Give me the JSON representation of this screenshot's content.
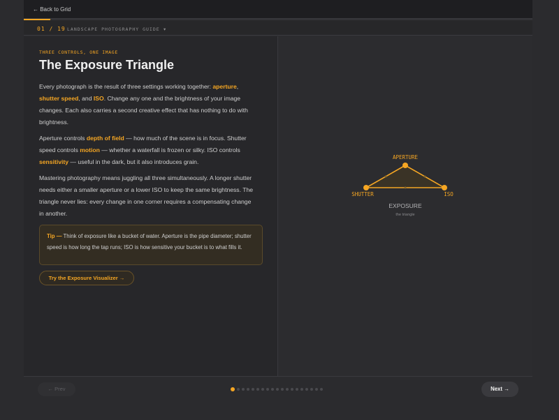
{
  "nav": {
    "back_label": "← Back to Grid",
    "counter": "01 / 19",
    "guide_title": "LANDSCAPE PHOTOGRAPHY GUIDE",
    "guide_caret": "▾",
    "progress_fraction": 0.0526
  },
  "lesson": {
    "kicker": "THREE CONTROLS, ONE IMAGE",
    "title": "The Exposure Triangle",
    "p1": {
      "t1": "Every photograph is the result of three settings working together: ",
      "k1": "aperture",
      "t2": ", ",
      "k2": "shutter speed",
      "t3": ", and ",
      "k3": "ISO",
      "t4": ". Change any one and the brightness of your image changes. Each also carries a second creative effect that has nothing to do with brightness."
    },
    "p2": {
      "t1": "Aperture controls ",
      "k1": "depth of field",
      "t2": " — how much of the scene is in focus. Shutter speed controls ",
      "k2": "motion",
      "t3": " — whether a waterfall is frozen or silky. ISO controls ",
      "k3": "sensitivity",
      "t4": " — useful in the dark, but it also introduces grain."
    },
    "p3": "Mastering photography means juggling all three simultaneously. A longer shutter needs either a smaller aperture or a lower ISO to keep the same brightness. The triangle never lies: every change in one corner requires a compensating change in another.",
    "tip": {
      "label": "Tip —",
      "text": " Think of exposure like a bucket of water. Aperture is the pipe diameter; shutter speed is how long the tap runs; ISO is how sensitive your bucket is to what fills it."
    },
    "cta_label": "Try the Exposure Visualizer →"
  },
  "diagram": {
    "top_label": "APERTURE",
    "left_label": "SHUTTER",
    "right_label": "ISO",
    "center_label": "EXPOSURE",
    "caption": "the triangle"
  },
  "footer": {
    "prev_label": "← Prev",
    "next_label": "Next →",
    "total_slides": 19,
    "current_slide": 1
  },
  "colors": {
    "accent": "#f5a623",
    "background": "#2b2b2e",
    "panel": "#27272a",
    "text": "#cfcfcf"
  }
}
